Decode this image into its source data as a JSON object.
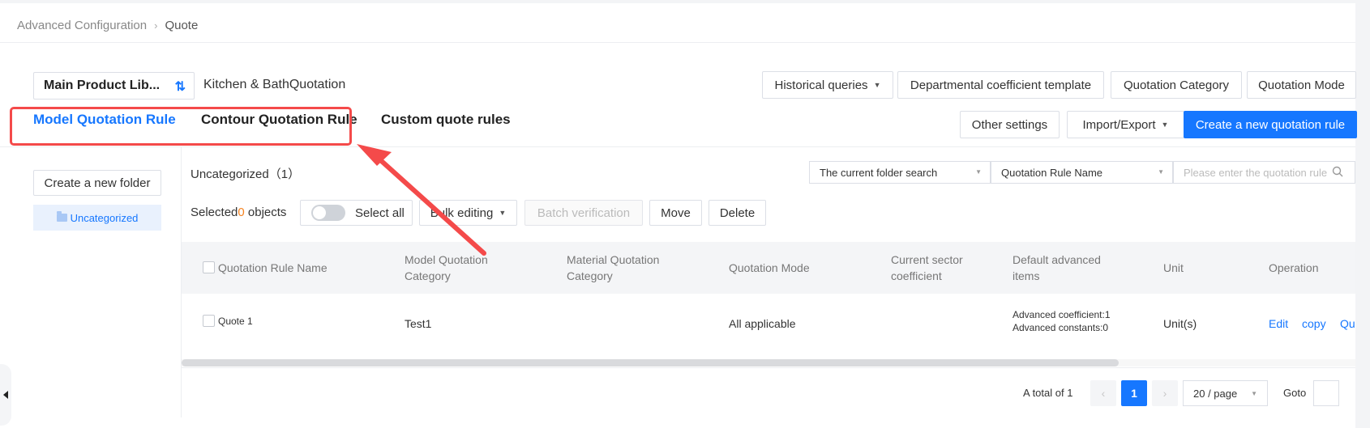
{
  "breadcrumb": {
    "parent": "Advanced Configuration",
    "current": "Quote"
  },
  "library": {
    "selected": "Main Product Lib...",
    "subtitle": "Kitchen & BathQuotation"
  },
  "toolbar_top": {
    "historical": "Historical queries",
    "dept_template": "Departmental coefficient template",
    "category": "Quotation Category",
    "mode": "Quotation Mode"
  },
  "toolbar_second": {
    "other_settings": "Other settings",
    "import_export": "Import/Export",
    "create": "Create a new quotation rule"
  },
  "tabs": [
    {
      "label": "Model Quotation Rule",
      "active": true
    },
    {
      "label": "Contour Quotation Rule",
      "active": false
    },
    {
      "label": "Custom quote rules",
      "active": false
    }
  ],
  "sidebar": {
    "new_folder": "Create a new folder",
    "folder": "Uncategorized"
  },
  "main": {
    "folder_title": "Uncategorized（1）",
    "search_scope": "The current folder search",
    "search_field": "Quotation Rule Name",
    "search_placeholder": "Please enter the quotation rule",
    "selected_prefix": "Selected",
    "selected_count": "0",
    "selected_suffix": "objects",
    "select_all": "Select all",
    "bulk_editing": "Bulk editing",
    "batch_verification": "Batch verification",
    "move": "Move",
    "delete": "Delete"
  },
  "table": {
    "headers": [
      "Quotation Rule Name",
      "Model Quotation Category",
      "Material Quotation Category",
      "Quotation Mode",
      "Current sector coefficient",
      "Default advanced items",
      "Unit",
      "Operation"
    ],
    "rows": [
      {
        "name": "Quote 1",
        "model_category": "Test1",
        "material_category": "",
        "mode": "All applicable",
        "sector_coefficient": "",
        "advanced_coefficient": "Advanced coefficient:1",
        "advanced_constants": "Advanced constants:0",
        "unit": "Unit(s)",
        "ops": [
          "Edit",
          "copy",
          "Qu"
        ]
      }
    ]
  },
  "pagination": {
    "total": "A total of 1",
    "prev": "‹",
    "current": "1",
    "next": "›",
    "page_size": "20 / page",
    "goto": "Goto"
  },
  "colors": {
    "accent": "#1677ff",
    "highlight": "#f44a4a",
    "count": "#f5821f"
  }
}
